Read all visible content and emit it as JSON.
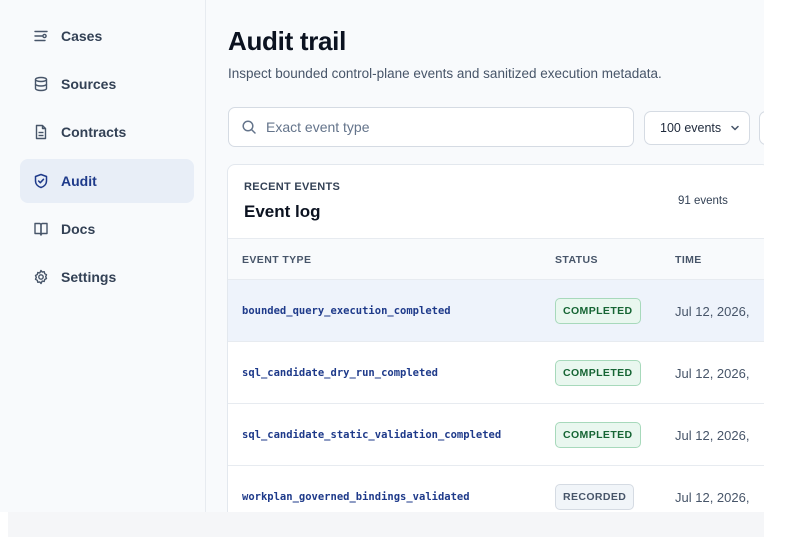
{
  "sidebar": {
    "items": [
      {
        "label": "Cases",
        "icon": "sliders-icon",
        "active": false
      },
      {
        "label": "Sources",
        "icon": "database-icon",
        "active": false
      },
      {
        "label": "Contracts",
        "icon": "file-text-icon",
        "active": false
      },
      {
        "label": "Audit",
        "icon": "shield-check-icon",
        "active": true
      },
      {
        "label": "Docs",
        "icon": "book-icon",
        "active": false
      },
      {
        "label": "Settings",
        "icon": "gear-icon",
        "active": false
      }
    ]
  },
  "header": {
    "title": "Audit trail",
    "subtitle": "Inspect bounded control-plane events and sanitized execution metadata."
  },
  "filters": {
    "search_placeholder": "Exact event type",
    "search_value": "",
    "limit_selected": "100 events"
  },
  "card": {
    "eyebrow": "RECENT EVENTS",
    "title": "Event log",
    "count": "91 events"
  },
  "table": {
    "columns": [
      "EVENT TYPE",
      "STATUS",
      "TIME"
    ],
    "rows": [
      {
        "event_type": "bounded_query_execution_completed",
        "status": "COMPLETED",
        "time": "Jul 12, 2026,",
        "highlighted": true
      },
      {
        "event_type": "sql_candidate_dry_run_completed",
        "status": "COMPLETED",
        "time": "Jul 12, 2026,",
        "highlighted": false
      },
      {
        "event_type": "sql_candidate_static_validation_completed",
        "status": "COMPLETED",
        "time": "Jul 12, 2026,",
        "highlighted": false
      },
      {
        "event_type": "workplan_governed_bindings_validated",
        "status": "RECORDED",
        "time": "Jul 12, 2026,",
        "highlighted": false
      }
    ]
  },
  "colors": {
    "accent": "#1e3a8a",
    "active_nav_bg": "#e8eef7",
    "completed_bg": "#e9f7ef",
    "completed_text": "#166534",
    "recorded_bg": "#f1f5f9"
  }
}
